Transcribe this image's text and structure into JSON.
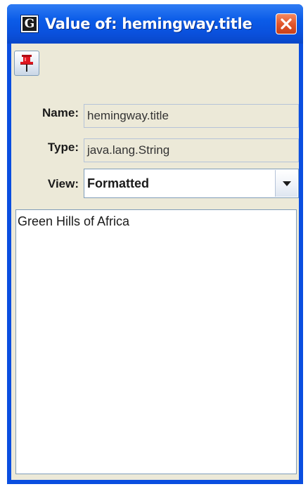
{
  "window": {
    "title": "Value of: hemingway.title",
    "app_icon_letter": "G",
    "title_bar_color": "#0a50dc",
    "close_button_color": "#e2562c"
  },
  "toolbar": {
    "pin_icon": "pushpin-icon",
    "pin_color": "#e0161f"
  },
  "fields": {
    "name_label": "Name:",
    "name_value": "hemingway.title",
    "type_label": "Type:",
    "type_value": "java.lang.String",
    "view_label": "View:",
    "view_selected": "Formatted"
  },
  "value_text": "Green Hills of Africa"
}
